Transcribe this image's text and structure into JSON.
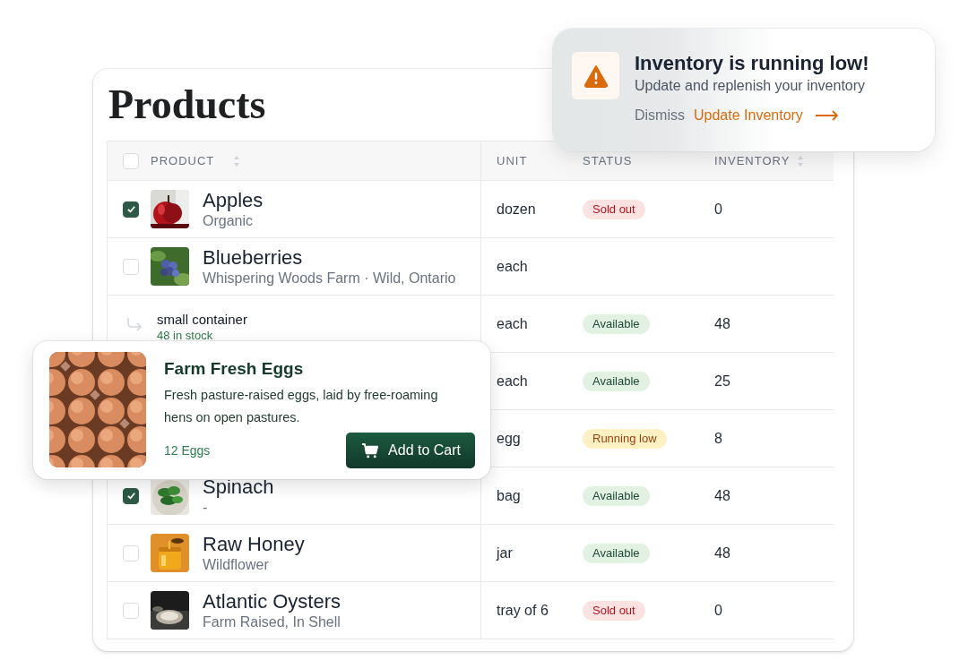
{
  "page": {
    "title": "Products"
  },
  "table": {
    "select_all": {
      "checked": false
    },
    "columns": [
      {
        "label": "PRODUCT",
        "sortable": true
      },
      {
        "label": "UNIT",
        "sortable": false
      },
      {
        "label": "STATUS",
        "sortable": false
      },
      {
        "label": "INVENTORY",
        "sortable": true
      }
    ],
    "rows": [
      {
        "kind": "product",
        "checked": true,
        "name": "Apples",
        "detail": "Organic",
        "unit": "dozen",
        "status": {
          "label": "Sold out",
          "kind": "sold_out"
        },
        "inventory": "0"
      },
      {
        "kind": "product",
        "checked": false,
        "name": "Blueberries",
        "detail": "Whispering Woods Farm · Wild, Ontario",
        "unit": "each"
      },
      {
        "kind": "variant",
        "name": "small container",
        "detail": "48 in stock",
        "unit": "each",
        "status": {
          "label": "Available",
          "kind": "available"
        },
        "inventory": "48"
      },
      {
        "kind": "covered",
        "unit": "each",
        "status": {
          "label": "Available",
          "kind": "available"
        },
        "inventory": "25"
      },
      {
        "kind": "covered",
        "unit": "egg",
        "status": {
          "label": "Running low",
          "kind": "low"
        },
        "inventory": "8"
      },
      {
        "kind": "product",
        "checked": true,
        "name": "Spinach",
        "detail": "-",
        "unit": "bag",
        "status": {
          "label": "Available",
          "kind": "available"
        },
        "inventory": "48"
      },
      {
        "kind": "product",
        "checked": false,
        "name": "Raw Honey",
        "detail": "Wildflower",
        "unit": "jar",
        "status": {
          "label": "Available",
          "kind": "available"
        },
        "inventory": "48"
      },
      {
        "kind": "product",
        "checked": false,
        "name": "Atlantic Oysters",
        "detail": "Farm Raised, In Shell",
        "unit": "tray of 6",
        "status": {
          "label": "Sold out",
          "kind": "sold_out"
        },
        "inventory": "0"
      }
    ]
  },
  "toast": {
    "title": "Inventory is running low!",
    "message": "Update and replenish your inventory",
    "dismiss": "Dismiss",
    "action": "Update Inventory"
  },
  "product_card": {
    "title": "Farm Fresh Eggs",
    "description": "Fresh pasture-raised eggs, laid by free-roaming hens on open pastures.",
    "quantity": "12 Eggs",
    "button": "Add to Cart"
  }
}
